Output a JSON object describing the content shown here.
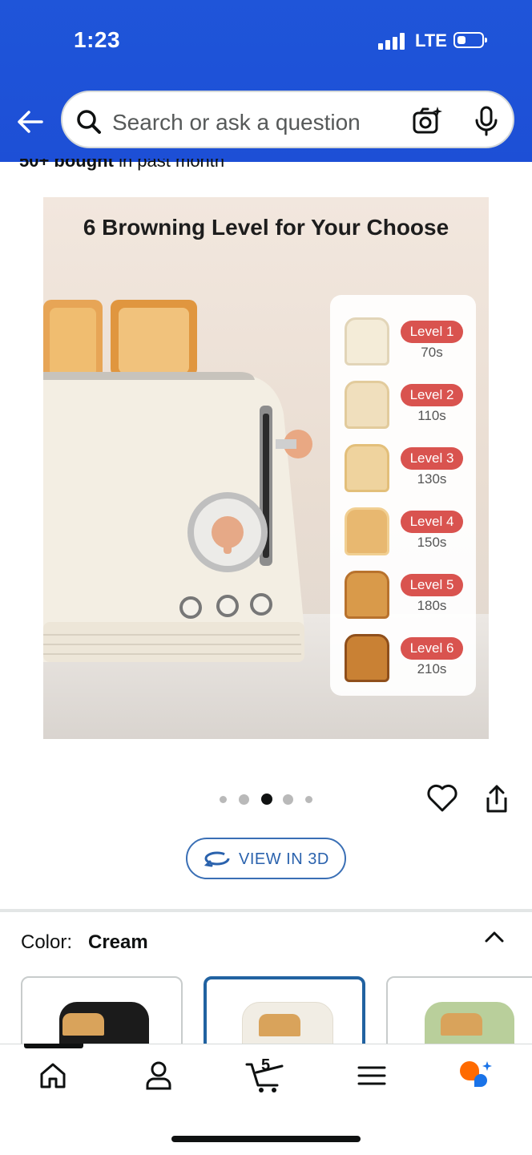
{
  "status_bar": {
    "time": "1:23",
    "network": "LTE"
  },
  "search": {
    "placeholder": "Search or ask a question"
  },
  "product": {
    "bought_bold": "50+ bought",
    "bought_rest": " in past month",
    "image": {
      "headline": "6 Browning Level for Your Choose",
      "levels": [
        {
          "label": "Level 1",
          "time": "70s",
          "color": "#f4ecd8"
        },
        {
          "label": "Level 2",
          "time": "110s",
          "color": "#f0dfbd"
        },
        {
          "label": "Level 3",
          "time": "130s",
          "color": "#efd39e"
        },
        {
          "label": "Level 4",
          "time": "150s",
          "color": "#e8b870"
        },
        {
          "label": "Level 5",
          "time": "180s",
          "color": "#d99a4a"
        },
        {
          "label": "Level 6",
          "time": "210s",
          "color": "#c98134"
        }
      ],
      "badge_color": "#d9534f"
    },
    "carousel": {
      "count": 5,
      "active_index": 2
    },
    "view_3d_label": "VIEW IN 3D",
    "color": {
      "label": "Color:",
      "value": "Cream"
    },
    "swatches": [
      {
        "name": "Black",
        "color": "#1b1b1b"
      },
      {
        "name": "Cream",
        "color": "#f1ede4",
        "selected": true
      },
      {
        "name": "Green",
        "color": "#b9cf9b"
      }
    ]
  },
  "tabbar": {
    "cart_count": "5",
    "accent": "#ff6a00"
  },
  "colors": {
    "header": "#1d4fd6",
    "link": "#2a62ad"
  }
}
